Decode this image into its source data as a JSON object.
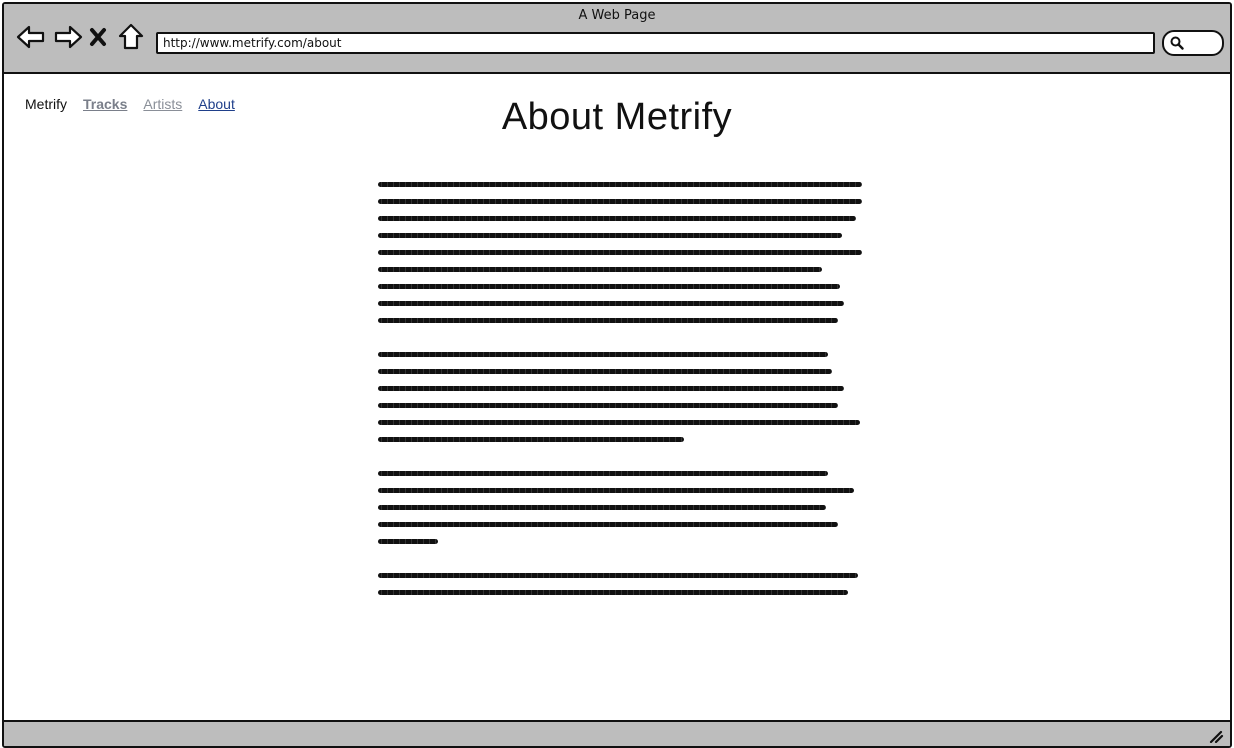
{
  "window": {
    "title": "A Web Page"
  },
  "toolbar": {
    "back_icon": "back-arrow-icon",
    "forward_icon": "forward-arrow-icon",
    "stop_icon": "close-x-icon",
    "home_icon": "home-icon"
  },
  "address_bar": {
    "url": "http://www.metrify.com/about"
  },
  "search": {
    "icon": "search-icon"
  },
  "nav": {
    "brand": "Metrify",
    "links": [
      {
        "label": "Tracks"
      },
      {
        "label": "Artists"
      },
      {
        "label": "About"
      }
    ]
  },
  "page": {
    "title": "About Metrify"
  },
  "colors": {
    "chrome": "#bdbdbd",
    "link_active": "#1f3f8a",
    "link_visited": "#7a7f8a"
  }
}
